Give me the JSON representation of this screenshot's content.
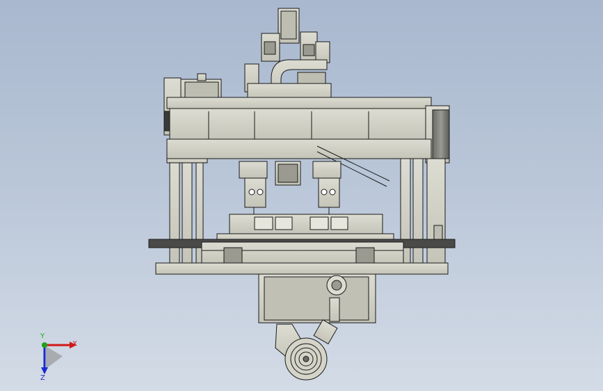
{
  "viewport": {
    "background_top": "#a9b8cf",
    "background_bottom": "#d3dbe6",
    "model_fill": "#cfcfc4",
    "model_shadow": "#b3b3a8",
    "model_edge": "#1a1a1a"
  },
  "triad": {
    "x_label": "X",
    "y_label": "Y",
    "z_label": "Z",
    "x_color": "#d01818",
    "y_color": "#1aa31a",
    "z_color": "#1a2ad0"
  }
}
